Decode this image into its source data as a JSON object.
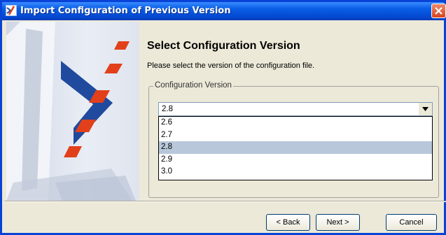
{
  "window": {
    "title": "Import Configuration of Previous Version",
    "app_icon": "x-logo-icon",
    "close_icon": "close-icon"
  },
  "main": {
    "heading": "Select Configuration Version",
    "instruction": "Please select the version of the configuration file.",
    "group_label": "Configuration Version",
    "combo": {
      "value": "2.8",
      "arrow_icon": "chevron-down-icon",
      "options": [
        {
          "label": "2.6",
          "selected": false
        },
        {
          "label": "2.7",
          "selected": false
        },
        {
          "label": "2.8",
          "selected": true
        },
        {
          "label": "2.9",
          "selected": false
        },
        {
          "label": "3.0",
          "selected": false
        }
      ]
    }
  },
  "buttons": {
    "back": "< Back",
    "next": "Next >",
    "cancel": "Cancel"
  },
  "colors": {
    "titlebar": "#0a5fe6",
    "selected_option": "#b8c7da",
    "logo_blue": "#1f4a9e",
    "logo_red": "#e2401b"
  }
}
